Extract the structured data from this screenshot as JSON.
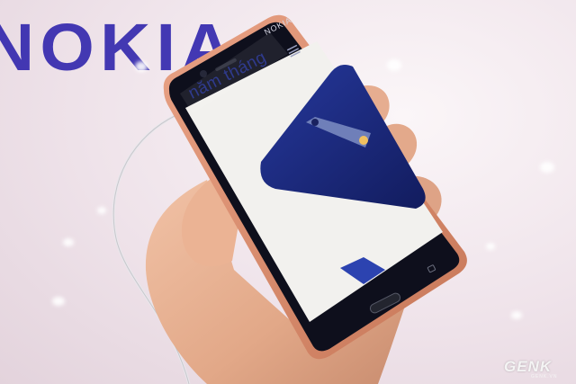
{
  "backdrop": {
    "brand_text": "NOKIA"
  },
  "phone": {
    "logo_text": "NOKIA",
    "screen_text": "năm tháng"
  },
  "watermark": {
    "text": "GENK",
    "sub": "GENK.VN"
  },
  "colors": {
    "brand": "#3a2fb0",
    "phone_body": "#d98b6c",
    "phone_screen_blue": "#1f2f8a",
    "screen_bg": "#f2f1ee",
    "skin": "#e9b497"
  },
  "icons": [
    "menu-icon",
    "camera-icon",
    "home-button-icon",
    "back-key-icon"
  ]
}
